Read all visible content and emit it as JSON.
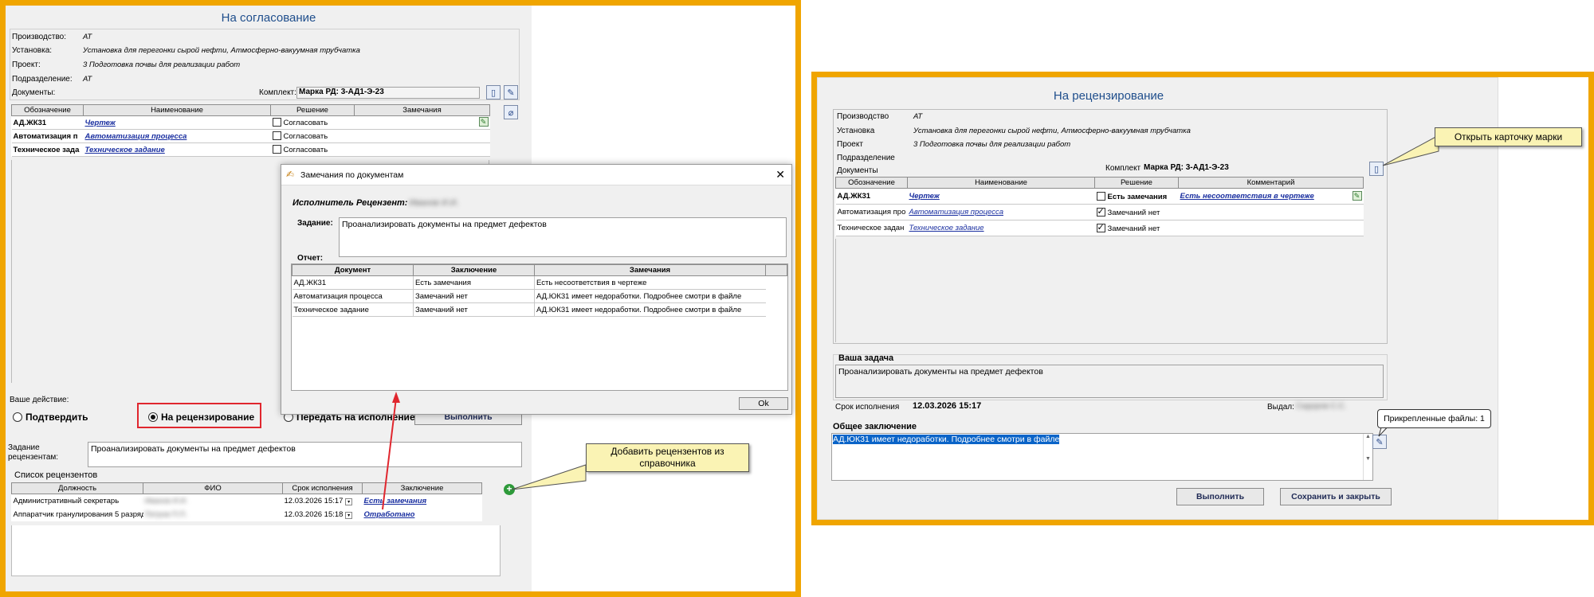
{
  "left": {
    "title": "На согласование",
    "fields": [
      {
        "label": "Производство:",
        "value": "АТ"
      },
      {
        "label": "Установка:",
        "value": "Установка для перегонки сырой нефти, Атмосферно-вакуумная трубчатка"
      },
      {
        "label": "Проект:",
        "value": "3 Подготовка почвы для реализации работ"
      },
      {
        "label": "Подразделение:",
        "value": "АТ"
      },
      {
        "label": "Документы:",
        "value": ""
      }
    ],
    "komplekt_label": "Комплект:",
    "komplekt_value": "Марка РД: 3-АД1-Э-23",
    "doc_headers": [
      "Обозначение",
      "Наименование",
      "Решение",
      "Замечания"
    ],
    "docs": [
      {
        "code": "АД.ЖК31",
        "name": "Чертеж",
        "decision": "Согласовать",
        "remark": ""
      },
      {
        "code": "Автоматизация п",
        "name": "Автоматизация процесса",
        "decision": "Согласовать",
        "remark": ""
      },
      {
        "code": "Техническое зада",
        "name": "Техническое задание",
        "decision": "Согласовать",
        "remark": ""
      }
    ],
    "action_label": "Ваше действие:",
    "radio_confirm": "Подтвердить",
    "radio_review": "На рецензирование",
    "radio_execute": "Передать на исполнение",
    "execute_button": "Выполнить",
    "task_label": "Задание рецензентам:",
    "task_value": "Проанализировать документы на предмет дефектов",
    "reviewers_title": "Список рецензентов",
    "reviewer_headers": [
      "Должность",
      "ФИО",
      "Срок исполнения",
      "Заключение"
    ],
    "reviewers": [
      {
        "position": "Административный секретарь",
        "name": "Иванов И.И.",
        "deadline": "12.03.2026 15:17",
        "conclusion": "Есть замечания"
      },
      {
        "position": "Аппаратчик гранулирования 5 разряд",
        "name": "Петров П.П.",
        "deadline": "12.03.2026 15:18",
        "conclusion": "Отработано"
      }
    ]
  },
  "dialog": {
    "title": "Замечания по документам",
    "executor_label": "Исполнитель Рецензент:",
    "executor_name": "Иванов И.И.",
    "task_label": "Задание:",
    "task_value": "Проанализировать документы на предмет дефектов",
    "report_label": "Отчет:",
    "headers": [
      "Документ",
      "Заключение",
      "Замечания"
    ],
    "rows": [
      {
        "doc": "АД.ЖК31",
        "conclusion": "Есть замечания",
        "remark": "Есть несоответствия в чертеже"
      },
      {
        "doc": "Автоматизация процесса",
        "conclusion": "Замечаний нет",
        "remark": "АД.ЮК31 имеет недоработки. Подробнее смотри в файле"
      },
      {
        "doc": "Техническое задание",
        "conclusion": "Замечаний нет",
        "remark": "АД.ЮК31 имеет недоработки. Подробнее смотри в файле"
      }
    ],
    "ok_button": "Ok",
    "close_glyph": "✕"
  },
  "right": {
    "title": "На рецензирование",
    "fields": [
      {
        "label": "Производство",
        "value": "АТ"
      },
      {
        "label": "Установка",
        "value": "Установка для перегонки сырой нефти, Атмосферно-вакуумная трубчатка"
      },
      {
        "label": "Проект",
        "value": "3 Подготовка почвы для реализации работ"
      },
      {
        "label": "Подразделение",
        "value": ""
      },
      {
        "label": "Документы",
        "value": ""
      }
    ],
    "komplekt_label": "Комплект",
    "komplekt_value": "Марка РД: 3-АД1-Э-23",
    "doc_headers": [
      "Обозначение",
      "Наименование",
      "Решение",
      "Комментарий"
    ],
    "docs": [
      {
        "code": "АД.ЖК31",
        "name": "Чертеж",
        "decision": "Есть замечания",
        "checked": false,
        "comment": "Есть несоответствия в чертеже"
      },
      {
        "code": "Автоматизация про",
        "name": "Автоматизация процесса",
        "decision": "Замечаний нет",
        "checked": true,
        "comment": ""
      },
      {
        "code": "Техническое задан",
        "name": "Техническое задание",
        "decision": "Замечаний нет",
        "checked": true,
        "comment": ""
      }
    ],
    "your_task_label": "Ваша задача",
    "your_task_value": "Проанализировать документы на предмет дефектов",
    "deadline_label": "Срок исполнения",
    "deadline_value": "12.03.2026 15:17",
    "issued_label": "Выдал:",
    "issued_value": "Сидоров С.С.",
    "conclusion_label": "Общее заключение",
    "conclusion_value": "АД.ЮК31 имеет недоработки. Подробнее смотри в файле",
    "execute_button": "Выполнить",
    "save_close_button": "Сохранить и закрыть"
  },
  "callouts": {
    "add_reviewers": "Добавить рецензентов из справочника",
    "open_card": "Открыть карточку марки",
    "attached_files": "Прикрепленные файлы: 1"
  },
  "colors": {
    "frame": "#f0a500",
    "title": "#1f4e8c",
    "link": "#1a2fa0",
    "callout": "#faf3b4",
    "highlight": "#e0262e"
  }
}
